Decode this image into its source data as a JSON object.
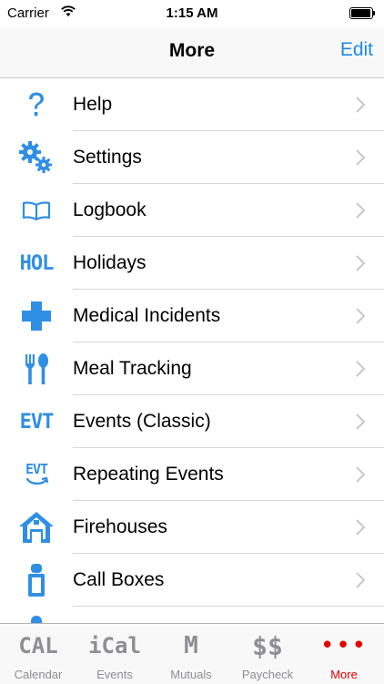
{
  "status_bar": {
    "carrier": "Carrier",
    "time": "1:15 AM"
  },
  "nav": {
    "title": "More",
    "edit_label": "Edit"
  },
  "icon_text": {
    "hol": "HOL",
    "evt": "EVT"
  },
  "menu": [
    {
      "label": "Help",
      "icon": "help-icon"
    },
    {
      "label": "Settings",
      "icon": "gears-icon"
    },
    {
      "label": "Logbook",
      "icon": "book-icon"
    },
    {
      "label": "Holidays",
      "icon": "hol-icon"
    },
    {
      "label": "Medical Incidents",
      "icon": "medical-cross-icon"
    },
    {
      "label": "Meal Tracking",
      "icon": "fork-spoon-icon"
    },
    {
      "label": "Events (Classic)",
      "icon": "evt-icon"
    },
    {
      "label": "Repeating Events",
      "icon": "repeat-evt-icon"
    },
    {
      "label": "Firehouses",
      "icon": "house-icon"
    },
    {
      "label": "Call Boxes",
      "icon": "call-box-icon"
    }
  ],
  "tabs": [
    {
      "label": "Calendar",
      "glyph": "CAL",
      "icon": "cal-icon"
    },
    {
      "label": "Events",
      "glyph": "iCal",
      "icon": "ical-icon"
    },
    {
      "label": "Mutuals",
      "glyph": "M",
      "icon": "mutuals-icon"
    },
    {
      "label": "Paycheck",
      "glyph": "$$",
      "icon": "paycheck-icon"
    },
    {
      "label": "More",
      "glyph": "•••",
      "icon": "more-dots-icon",
      "active": true
    }
  ],
  "colors": {
    "accent": "#1f87e6",
    "icon_blue": "#2f8fe4",
    "tab_inactive": "#8e8e93",
    "tab_active": "#e10000"
  }
}
